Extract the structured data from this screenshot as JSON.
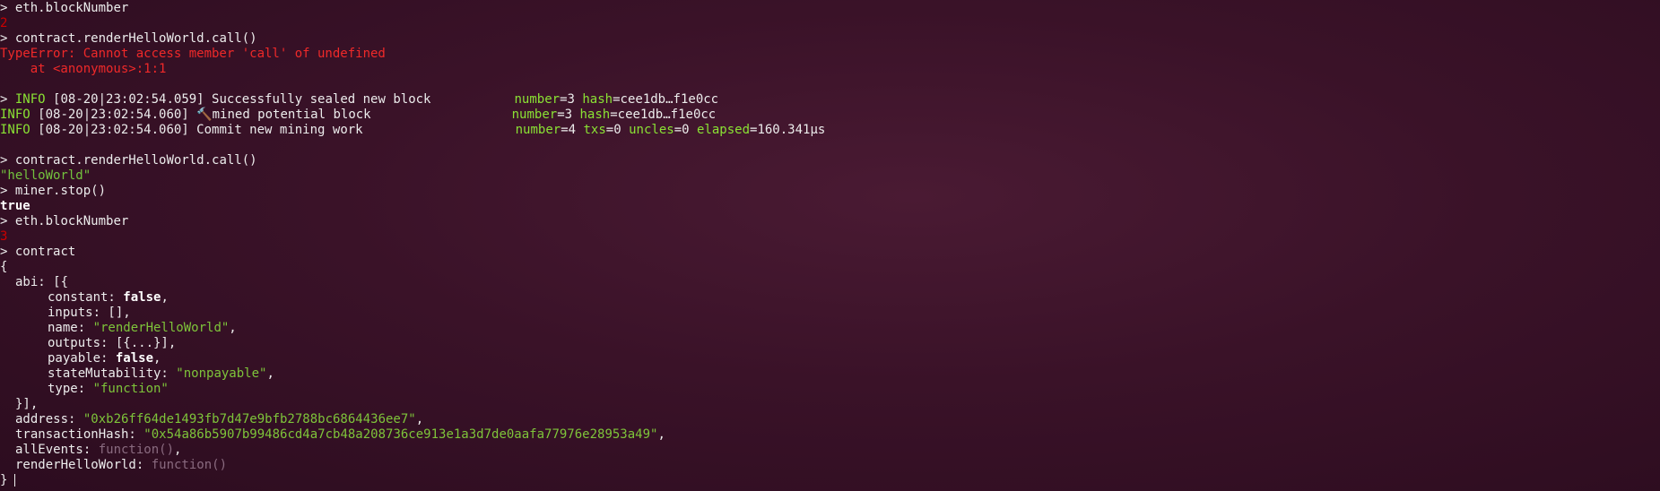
{
  "prompt": ">",
  "lines": {
    "l1_cmd": "eth.blockNumber",
    "l2_out": "2",
    "l3_cmd": "contract.renderHelloWorld.call()",
    "l4_err": "TypeError: Cannot access member 'call' of undefined",
    "l5_err": "    at <anonymous>:1:1",
    "l7_level": "INFO",
    "l7_time": "[08-20|23:02:54.059]",
    "l7_msg": "Successfully sealed new block",
    "l7_k1": "number",
    "l7_v1": "3",
    "l7_k2": "hash",
    "l7_v2": "cee1db…f1e0cc",
    "l8_level": "INFO",
    "l8_time": "[08-20|23:02:54.060]",
    "l8_msg": "🔨mined potential block",
    "l8_k1": "number",
    "l8_v1": "3",
    "l8_k2": "hash",
    "l8_v2": "cee1db…f1e0cc",
    "l9_level": "INFO",
    "l9_time": "[08-20|23:02:54.060]",
    "l9_msg": "Commit new mining work",
    "l9_k1": "number",
    "l9_v1": "4",
    "l9_k2": "txs",
    "l9_v2": "0",
    "l9_k3": "uncles",
    "l9_v3": "0",
    "l9_k4": "elapsed",
    "l9_v4": "160.341µs",
    "l11_cmd": "contract.renderHelloWorld.call()",
    "l12_out": "\"helloWorld\"",
    "l13_cmd": "miner.stop()",
    "l14_out": "true",
    "l15_cmd": "eth.blockNumber",
    "l16_out": "3",
    "l17_cmd": "contract",
    "l18": "{",
    "abi_key": "abi: [{",
    "constant_key": "constant: ",
    "constant_val": "false",
    "inputs": "inputs: [],",
    "name_key": "name: ",
    "name_val": "\"renderHelloWorld\"",
    "outputs": "outputs: [{...}],",
    "payable_key": "payable: ",
    "payable_val": "false",
    "state_key": "stateMutability: ",
    "state_val": "\"nonpayable\"",
    "type_key": "type: ",
    "type_val": "\"function\"",
    "abi_close": "}],",
    "address_key": "address: ",
    "address_val": "\"0xb26ff64de1493fb7d47e9bfb2788bc6864436ee7\"",
    "tx_key": "transactionHash: ",
    "tx_val": "\"0x54a86b5907b99486cd4a7cb48a208736ce913e1a3d7de0aafa77976e28953a49\"",
    "events_key": "allEvents: ",
    "events_val": "function()",
    "render_key": "renderHelloWorld: ",
    "render_val": "function()",
    "close": "}"
  }
}
